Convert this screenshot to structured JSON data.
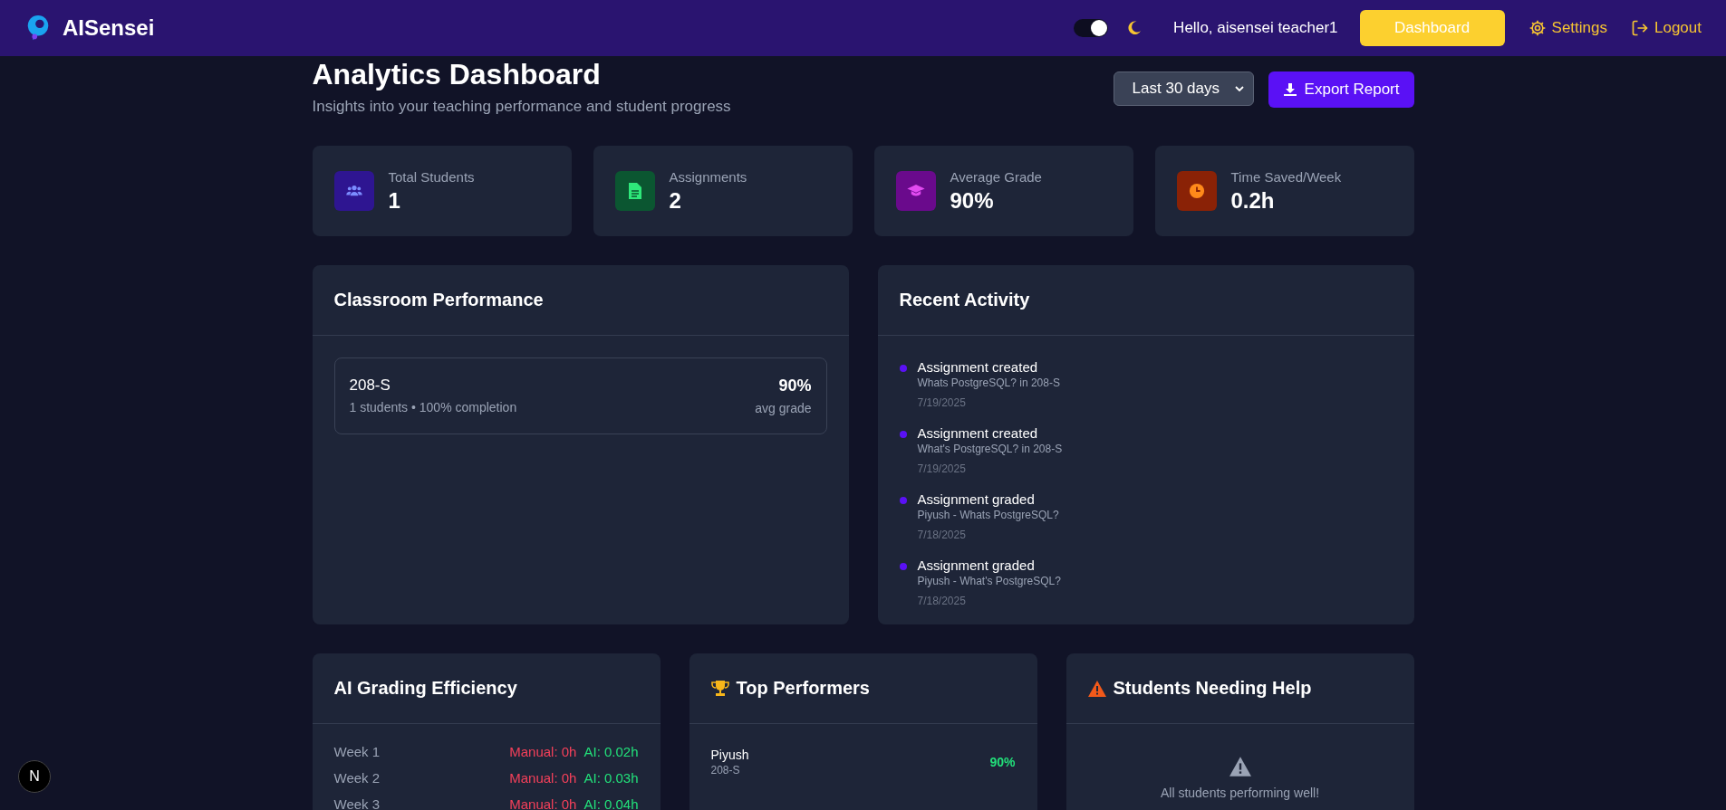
{
  "header": {
    "brand": "AISensei",
    "theme_toggle": {
      "on": true
    },
    "greeting": "Hello, aisensei teacher1",
    "nav": [
      {
        "label": "Dashboard",
        "kind": "primary"
      },
      {
        "label": "Settings",
        "kind": "settings"
      },
      {
        "label": "Logout",
        "kind": "logout"
      }
    ]
  },
  "page": {
    "title": "Analytics Dashboard",
    "subtitle": "Insights into your teaching performance and student progress",
    "range_select": {
      "value": "Last 30 days"
    },
    "export_button": "Export Report"
  },
  "stats": [
    {
      "label": "Total Students",
      "value": "1",
      "kind": "users",
      "color": "#2e1591"
    },
    {
      "label": "Assignments",
      "value": "2",
      "kind": "document",
      "color": "#0b5631"
    },
    {
      "label": "Average Grade",
      "value": "90%",
      "kind": "cap",
      "color": "#6a0a8c"
    },
    {
      "label": "Time Saved/Week",
      "value": "0.2h",
      "kind": "clock",
      "color": "#8a2206"
    }
  ],
  "classroom_performance": {
    "title": "Classroom Performance",
    "classes": [
      {
        "name": "208-S",
        "details": "1 students • 100% completion",
        "grade": "90%",
        "grade_label": "avg grade"
      }
    ]
  },
  "recent_activity": {
    "title": "Recent Activity",
    "items": [
      {
        "title": "Assignment created",
        "detail": "Whats PostgreSQL? in 208-S",
        "date": "7/19/2025"
      },
      {
        "title": "Assignment created",
        "detail": "What's PostgreSQL? in 208-S",
        "date": "7/19/2025"
      },
      {
        "title": "Assignment graded",
        "detail": "Piyush - Whats PostgreSQL?",
        "date": "7/18/2025"
      },
      {
        "title": "Assignment graded",
        "detail": "Piyush - What's PostgreSQL?",
        "date": "7/18/2025"
      }
    ]
  },
  "ai_grading_efficiency": {
    "title": "AI Grading Efficiency",
    "weeks": [
      {
        "week": "Week 1",
        "manual": "Manual: 0h",
        "ai": "AI: 0.02h"
      },
      {
        "week": "Week 2",
        "manual": "Manual: 0h",
        "ai": "AI: 0.03h"
      },
      {
        "week": "Week 3",
        "manual": "Manual: 0h",
        "ai": "AI: 0.04h"
      }
    ]
  },
  "top_performers": {
    "title": "Top Performers",
    "students": [
      {
        "name": "Piyush",
        "class": "208-S",
        "grade": "90%"
      }
    ]
  },
  "students_needing_help": {
    "title": "Students Needing Help",
    "empty_message": "All students performing well!"
  },
  "devtools_badge": "N"
}
